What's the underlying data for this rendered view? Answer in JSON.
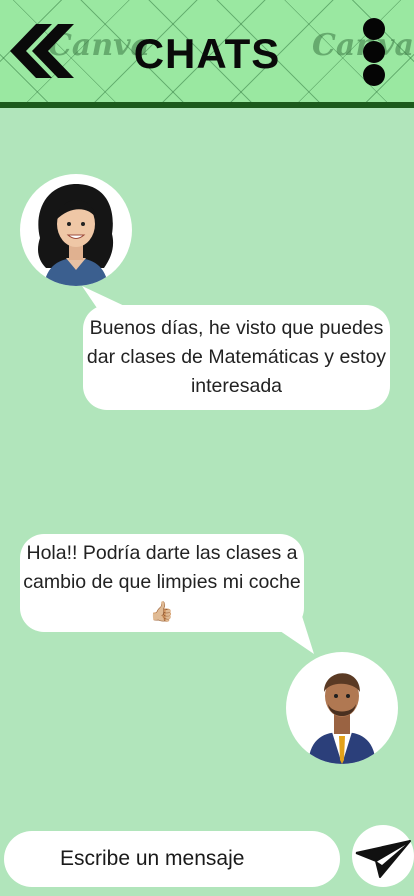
{
  "header": {
    "title": "CHATS",
    "watermark_left": "Canva",
    "watermark_right": "Canva",
    "back_icon": "double-chevron-left-icon",
    "menu_icon": "vertical-dots-icon",
    "colors": {
      "header_bg": "#9ae8a1",
      "header_bar": "#1c5a1c"
    }
  },
  "chat": {
    "messages": [
      {
        "sender": "received",
        "avatar": "woman-avatar-icon",
        "text": "Buenos días, he visto que puedes dar clases de Matemáticas y estoy interesada"
      },
      {
        "sender": "sent",
        "avatar": "man-avatar-icon",
        "text": "Hola!! Podría darte las clases a cambio de que limpies mi coche",
        "emoji": "👍🏼"
      }
    ],
    "colors": {
      "background": "#b1e5bb",
      "bubble": "#ffffff"
    }
  },
  "composer": {
    "placeholder": "Escribe un mensaje",
    "send_icon": "paper-plane-icon"
  }
}
